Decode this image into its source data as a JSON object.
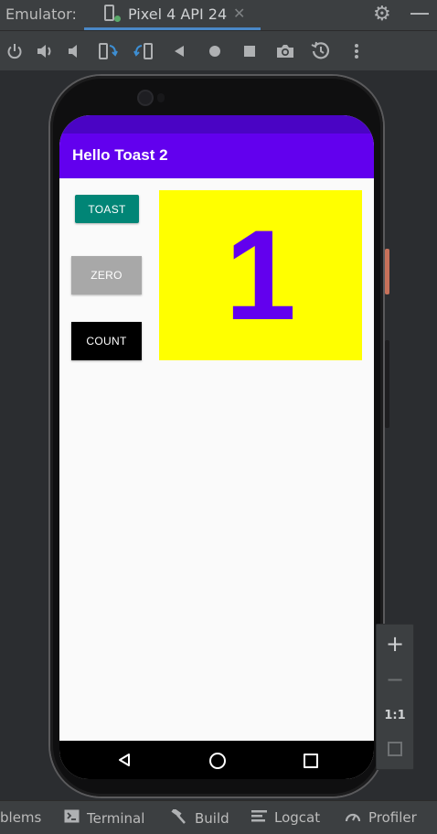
{
  "tabbar": {
    "app_label": "Emulator:",
    "device_tab": {
      "label": "Pixel 4 API 24",
      "close": "✕"
    },
    "icons": [
      "settings-icon",
      "minimize-icon"
    ]
  },
  "toolbar": {
    "icons": [
      "power-icon",
      "volume-up-icon",
      "volume-down-icon",
      "rotate-left-icon",
      "rotate-right-icon",
      "back-icon",
      "home-icon",
      "overview-icon",
      "screenshot-icon",
      "snapshot-icon",
      "more-icon"
    ]
  },
  "device": {
    "app_title": "Hello Toast 2",
    "buttons": {
      "toast": "TOAST",
      "zero": "ZERO",
      "count": "COUNT"
    },
    "count_value": "1",
    "colors": {
      "app_bar": "#6200ee",
      "status_bar": "#4a04c4",
      "toast_button": "#018576",
      "zero_button": "#a8a8a8",
      "count_button": "#000000",
      "count_bg": "#ffff00",
      "count_text": "#6200ee"
    },
    "nav_icons": [
      "nav-back-icon",
      "nav-home-icon",
      "nav-recents-icon"
    ]
  },
  "zoom": {
    "zoom_in": "+",
    "zoom_out": "−",
    "actual_size": "1:1"
  },
  "bottombar": {
    "items": [
      {
        "label": "blems"
      },
      {
        "label": "Terminal"
      },
      {
        "label": "Build"
      },
      {
        "label": "Logcat"
      },
      {
        "label": "Profiler"
      }
    ]
  }
}
